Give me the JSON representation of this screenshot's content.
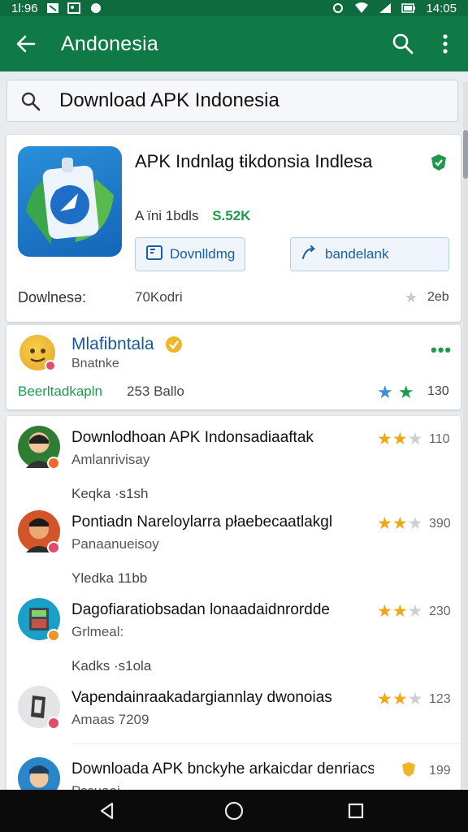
{
  "status_bar": {
    "time_left": "1Ɩ:96",
    "time_right": "14:05"
  },
  "app_bar": {
    "title": "Andonesia"
  },
  "search": {
    "query": "Download APK Indonesia"
  },
  "app": {
    "name": "APK Indnlag ŧikdonsia Indlesa",
    "meta_left": "A ïni  1bdls",
    "size": "S.52K",
    "download_label": "Dovnlldmg",
    "share_label": "bandelank",
    "downloads_label": "Dowlnesə:",
    "downloads_value": "70Kodri",
    "rating_count": "2eb"
  },
  "developer": {
    "name": "Mlafibntala",
    "subtitle": "Bnatnke",
    "action_label": "Beerltadkapln",
    "count": "253 Ballo",
    "rating": "130"
  },
  "list": [
    {
      "title": "Downlodhoan APK Indonsadiaaftak",
      "subtitle": "Amlanrivisay",
      "meta": "Keqka  ·s1sh",
      "rating_count": "110"
    },
    {
      "title": "Pontiadn Nareloylarra płaebecaatlakgl",
      "subtitle": "Panaanueisoy",
      "meta": "Yledka   11bb",
      "rating_count": "390"
    },
    {
      "title": "Dagofiaratiobsadan lonaadaidnrordde",
      "subtitle": "Grlmeal:",
      "meta": "Kadks   ·s1ola",
      "rating_count": "230"
    },
    {
      "title": "Vapendainraakadargiannlay dwonoias",
      "subtitle": "Amaas   7209",
      "meta": "",
      "rating_count": "123"
    },
    {
      "title": "Downloada APK bnckyhe arkaicdar denriacs",
      "subtitle": "Рознаоі",
      "meta": "",
      "rating_count": "199"
    }
  ],
  "colors": {
    "primary": "#0f7a46",
    "accent_green": "#1f9a4c",
    "link_blue": "#1b5796",
    "star": "#f2a516"
  }
}
